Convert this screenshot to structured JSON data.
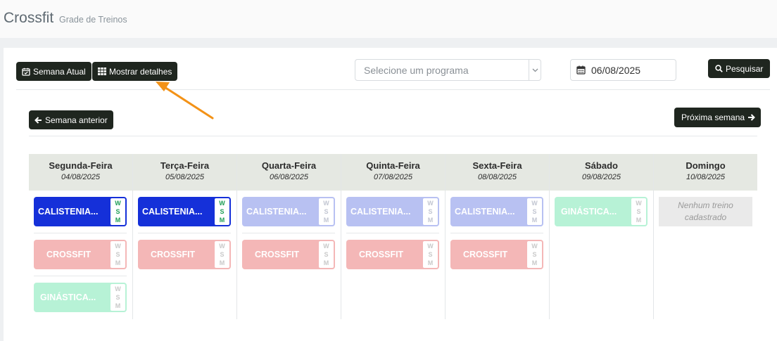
{
  "header": {
    "title": "Crossfit",
    "subtitle": "Grade de Treinos"
  },
  "toolbar": {
    "current_week_label": "Semana Atual",
    "show_details_label": "Mostrar detalhes",
    "program_placeholder": "Selecione um programa",
    "date_value": "06/08/2025",
    "search_label": "Pesquisar"
  },
  "nav": {
    "prev_week_label": "Semana anterior",
    "next_week_label": "Próxima semana"
  },
  "wsm": {
    "w": "W",
    "s": "S",
    "m": "M"
  },
  "days": [
    {
      "name": "Segunda-Feira",
      "date": "04/08/2025"
    },
    {
      "name": "Terça-Feira",
      "date": "05/08/2025"
    },
    {
      "name": "Quarta-Feira",
      "date": "06/08/2025"
    },
    {
      "name": "Quinta-Feira",
      "date": "07/08/2025"
    },
    {
      "name": "Sexta-Feira",
      "date": "08/08/2025"
    },
    {
      "name": "Sábado",
      "date": "09/08/2025"
    },
    {
      "name": "Domingo",
      "date": "10/08/2025"
    }
  ],
  "trainings": {
    "calistenia": "CALISTENIA...",
    "crossfit": "CROSSFIT",
    "ginastica": "GINÁSTICA..."
  },
  "empty_day_text": "Nenhum treino cadastrado",
  "colors": {
    "calistenia_active": "#1530d9",
    "calistenia_inactive": "#b8c1f2",
    "crossfit": "#f4b7b7",
    "ginastica": "#b7f2d6",
    "annotation_arrow": "#f39217"
  }
}
